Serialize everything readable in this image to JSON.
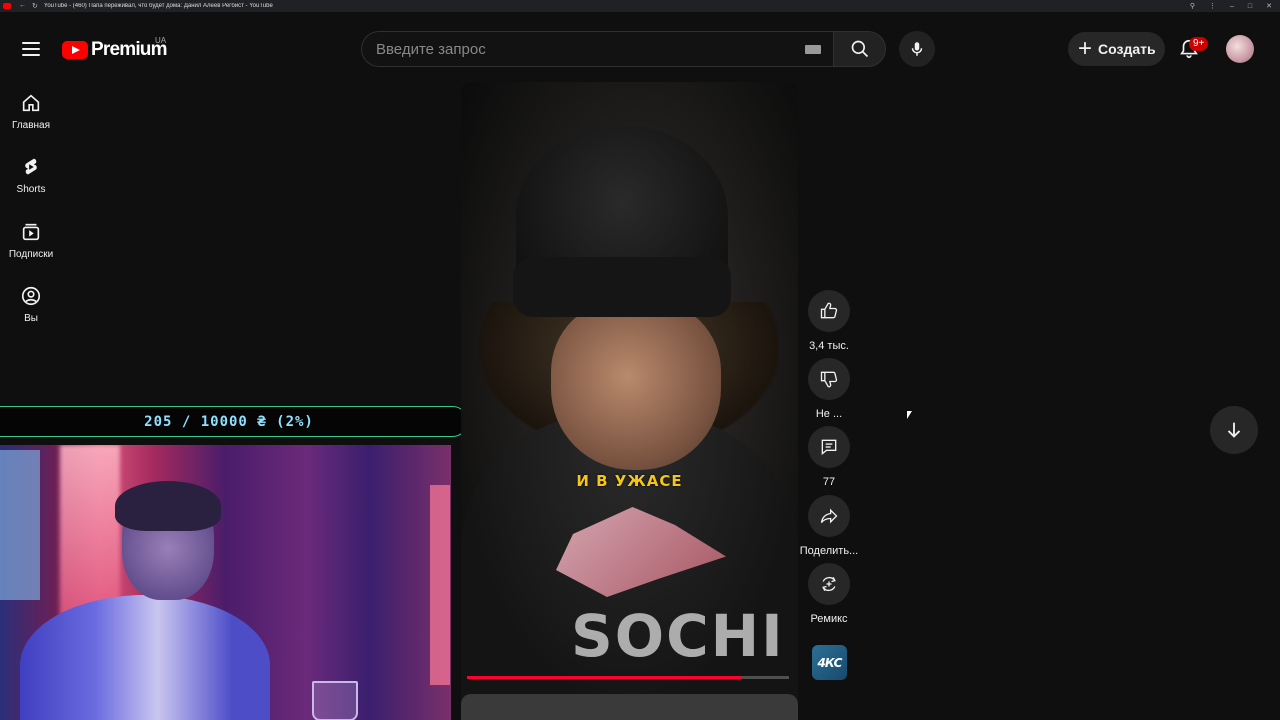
{
  "browser": {
    "tab_title": "YouTube - (460) Папа переживал, что будет дома: Данил Алеев Регбист - YouTube"
  },
  "masthead": {
    "logo_text": "Premium",
    "country_code": "UA",
    "search_placeholder": "Введите запрос",
    "create_label": "Создать",
    "notification_count": "9+"
  },
  "guide": {
    "items": [
      {
        "label": "Главная",
        "icon": "home-icon"
      },
      {
        "label": "Shorts",
        "icon": "shorts-icon"
      },
      {
        "label": "Подписки",
        "icon": "subscriptions-icon"
      },
      {
        "label": "Вы",
        "icon": "you-icon"
      }
    ]
  },
  "donation": {
    "text": "205 / 10000 ₴ (2%)",
    "progress_fraction": 0.02
  },
  "player": {
    "caption": "И В УЖАСЕ",
    "shirt_text": "SOCHI",
    "progress_fraction": 0.85
  },
  "actions": {
    "like_label": "3,4 тыс.",
    "dislike_label": "Не ...",
    "comments_label": "77",
    "share_label": "Поделить...",
    "remix_label": "Ремикс"
  },
  "channel": {
    "thumb_text": "4КС"
  },
  "colors": {
    "accent_red": "#ff0000",
    "caption_yellow": "#f5c518",
    "donation_border": "#36c98b",
    "donation_text": "#8fe0ff"
  }
}
